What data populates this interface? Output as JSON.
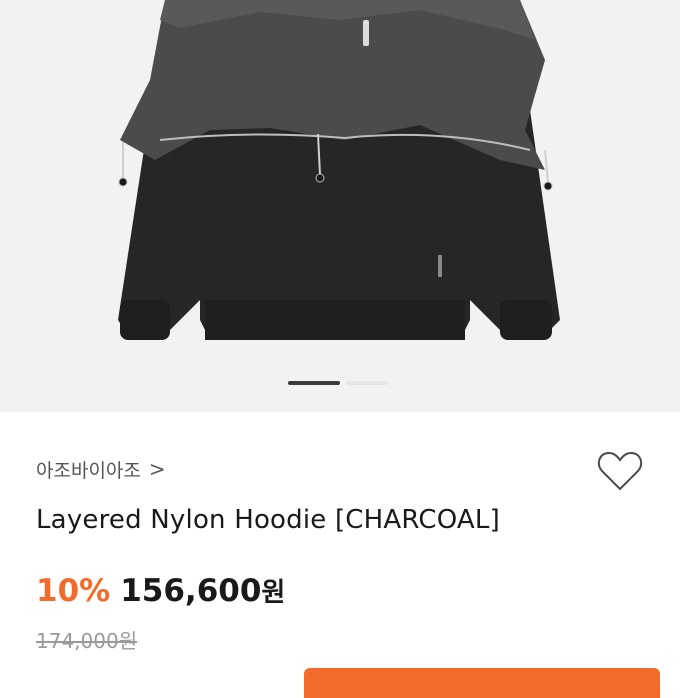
{
  "product": {
    "brand": "아조바이아조",
    "brand_chevron": ">",
    "name": "Layered Nylon Hoodie [CHARCOAL]",
    "discount": "10%",
    "price": "156,600",
    "price_unit": "원",
    "original_price": "174,000원"
  },
  "gallery": {
    "active_index": 0,
    "total": 2
  },
  "colors": {
    "accent": "#f26b2a",
    "text": "#1a1a1a",
    "muted": "#9a9a9a"
  },
  "icons": {
    "wishlist": "heart-outline-icon"
  }
}
